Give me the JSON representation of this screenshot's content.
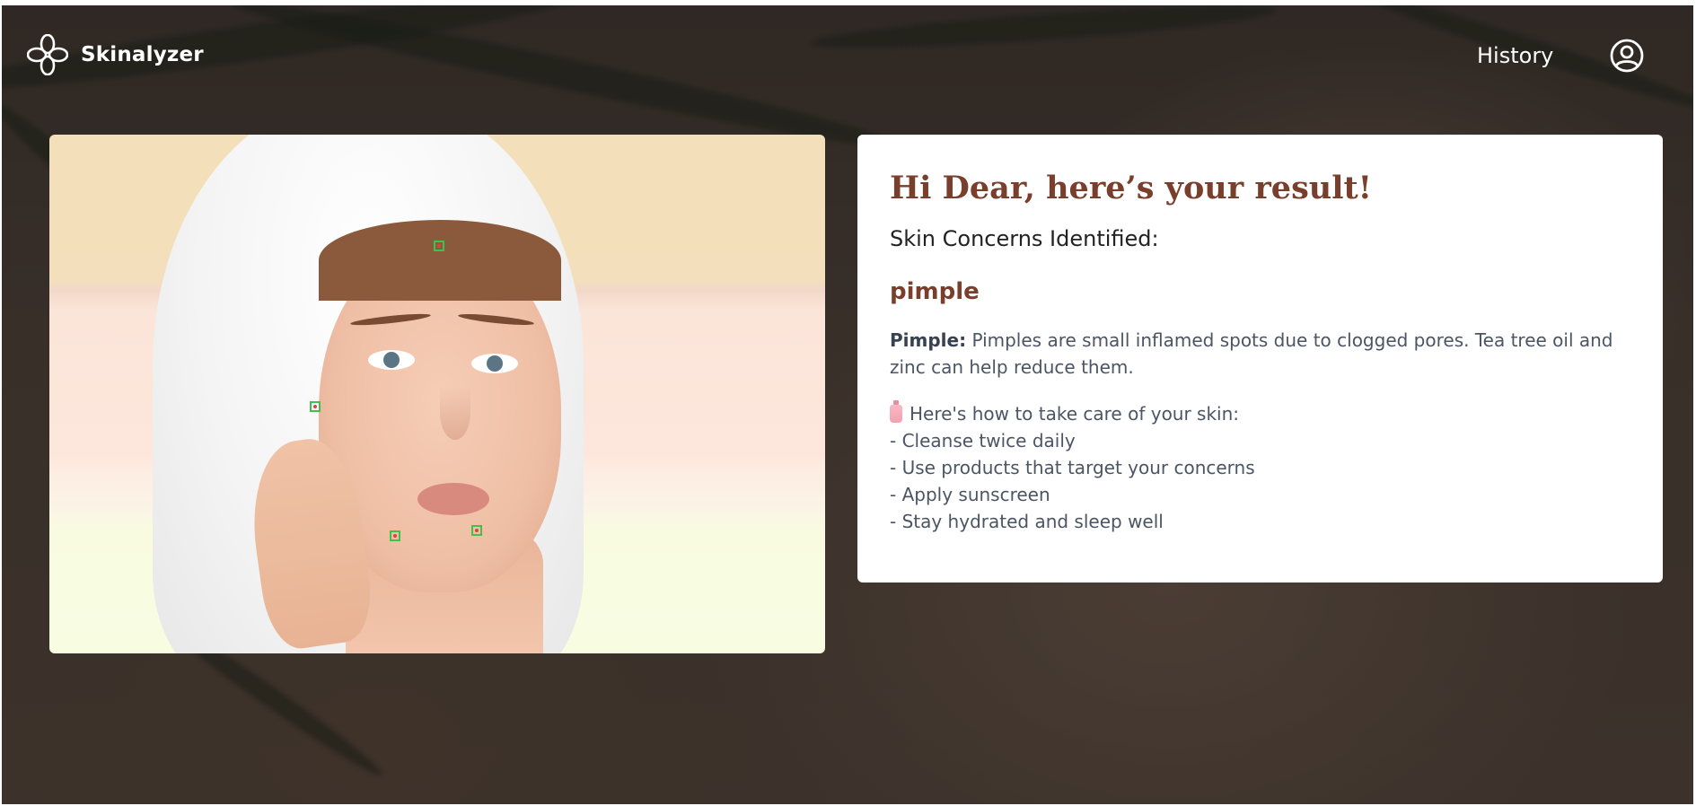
{
  "header": {
    "brand": "Skinalyzer",
    "logo_icon": "flower-logo-icon",
    "nav_history": "History",
    "account_icon": "user-circle-icon"
  },
  "image_panel": {
    "detections_count_label": "",
    "detection_color": "#3ec24a"
  },
  "result": {
    "title": "Hi Dear, here’s your result!",
    "concerns_label": "Skin Concerns Identified:",
    "concern_name": "pimple",
    "description_term": "Pimple:",
    "description_text": "Pimples are small inflamed spots due to clogged pores. Tea tree oil and zinc can help reduce them.",
    "care_intro_icon": "lotion-bottle-icon",
    "care_intro": "Here's how to take care of your skin:",
    "care_tips": [
      "- Cleanse twice daily",
      "- Use products that target your concerns",
      "- Apply sunscreen",
      "- Stay hydrated and sleep well"
    ]
  },
  "colors": {
    "accent_brown": "#7a3e2c",
    "body_text": "#4b5563"
  }
}
